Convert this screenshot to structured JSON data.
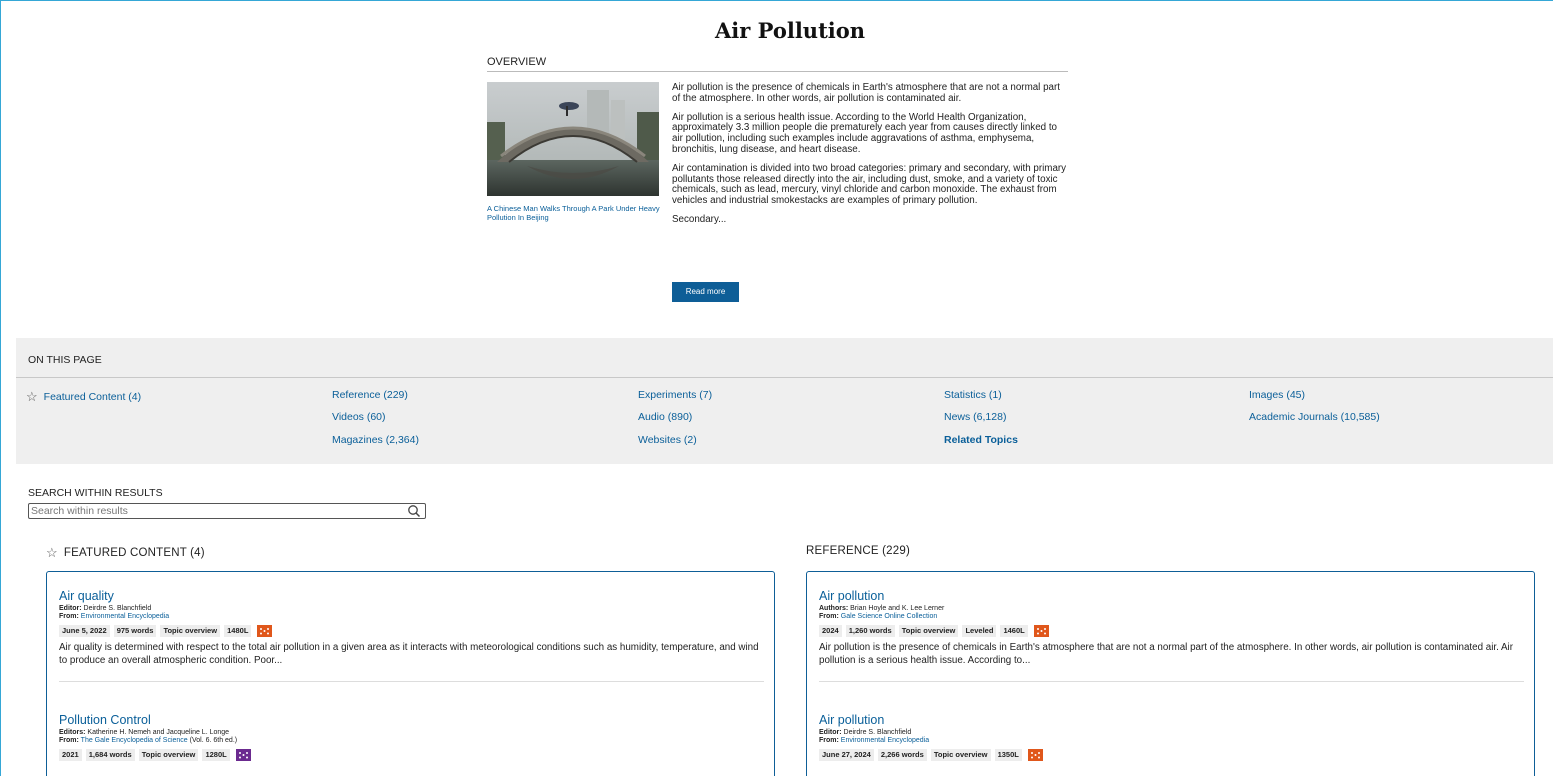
{
  "page_title": "Air Pollution",
  "overview": {
    "heading": "OVERVIEW",
    "image_caption": "A Chinese Man Walks Through A Park Under Heavy Pollution In Beijing",
    "paragraphs": [
      "Air pollution is the presence of chemicals in Earth's atmosphere that are not a normal part of the atmosphere. In other words, air pollution is contaminated air.",
      "Air pollution is a serious health issue. According to the World Health Organization, approximately 3.3 million people die prematurely each year from causes directly linked to air pollution, including such examples include aggravations of asthma, emphysema, bronchitis, lung disease, and heart disease.",
      "Air contamination is divided into two broad categories: primary and secondary, with primary pollutants those released directly into the air, including dust, smoke, and a variety of toxic chemicals, such as lead, mercury, vinyl chloride and carbon monoxide. The exhaust from vehicles and industrial smokestacks are examples of primary pollution.",
      "Secondary..."
    ],
    "read_more": "Read more"
  },
  "on_this_page": {
    "heading": "ON THIS PAGE",
    "items": [
      {
        "label": "Featured Content  (4)"
      },
      {
        "label": "Reference  (229)"
      },
      {
        "label": "Videos  (60)"
      },
      {
        "label": "Magazines  (2,364)"
      },
      {
        "label": "Experiments  (7)"
      },
      {
        "label": "Audio  (890)"
      },
      {
        "label": "Websites  (2)"
      },
      {
        "label": "Statistics  (1)"
      },
      {
        "label": "News  (6,128)"
      },
      {
        "label": "Related Topics"
      },
      {
        "label": "Images  (45)"
      },
      {
        "label": "Academic Journals  (10,585)"
      }
    ]
  },
  "search_within": {
    "heading": "SEARCH WITHIN RESULTS",
    "placeholder": "Search within results"
  },
  "featured": {
    "heading": "FEATURED CONTENT  (4)",
    "items": [
      {
        "title": "Air quality",
        "credit_label": "Editor:",
        "credit": "Deirdre S. Blanchfield",
        "from_label": "From:",
        "from": "Environmental Encyclopedia",
        "from_extra": "",
        "tags": [
          "June 5, 2022",
          "975 words",
          "Topic overview",
          "1480L"
        ],
        "lexile_color": "#e0571b",
        "description": "Air quality is determined with respect to the total air pollution in a given area as it interacts with meteorological conditions such as humidity, temperature, and wind to produce an overall atmospheric condition. Poor..."
      },
      {
        "title": "Pollution Control",
        "credit_label": "Editors:",
        "credit": "Katherine H. Nemeh and Jacqueline L. Longe",
        "from_label": "From:",
        "from": "The Gale Encyclopedia of Science",
        "from_extra": " (Vol. 6. 6th ed.)",
        "tags": [
          "2021",
          "1,684 words",
          "Topic overview",
          "1280L"
        ],
        "lexile_color": "#6b2a8f",
        "description": ""
      }
    ]
  },
  "reference": {
    "heading": "REFERENCE  (229)",
    "items": [
      {
        "title": "Air pollution",
        "credit_label": "Authors:",
        "credit": "Brian Hoyle and K. Lee Lerner",
        "from_label": "From:",
        "from": "Gale Science Online Collection",
        "from_extra": "",
        "tags": [
          "2024",
          "1,260 words",
          "Topic overview",
          "Leveled",
          "1460L"
        ],
        "lexile_color": "#e0571b",
        "description": "Air pollution is the presence of chemicals in Earth's atmosphere that are not a normal part of the atmosphere. In other words, air pollution is contaminated air. Air pollution is a serious health issue. According to..."
      },
      {
        "title": "Air pollution",
        "credit_label": "Editor:",
        "credit": "Deirdre S. Blanchfield",
        "from_label": "From:",
        "from": "Environmental Encyclopedia",
        "from_extra": "",
        "tags": [
          "June 27, 2024",
          "2,266 words",
          "Topic overview",
          "1350L"
        ],
        "lexile_color": "#e0571b",
        "description": ""
      }
    ]
  }
}
